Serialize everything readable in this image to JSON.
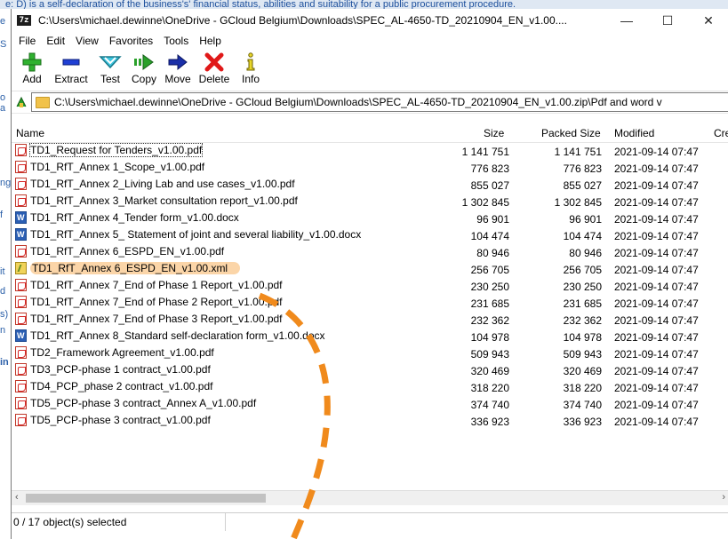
{
  "background_doc": {
    "top_text": "e: D) is a self-declaration of the business's' financial status, abilities and suitability for a public procurement procedure.",
    "letters": [
      "e",
      "S",
      "o",
      "a",
      "ng",
      "f",
      "it",
      "d",
      "s)",
      "n",
      "in"
    ]
  },
  "window": {
    "title": "C:\\Users\\michael.dewinne\\OneDrive - GCloud Belgium\\Downloads\\SPEC_AL-4650-TD_20210904_EN_v1.00....",
    "app_icon_text": "7z",
    "buttons": {
      "minimize": "—",
      "maximize": "☐",
      "close": "✕"
    }
  },
  "menu": [
    "File",
    "Edit",
    "View",
    "Favorites",
    "Tools",
    "Help"
  ],
  "toolbar": [
    {
      "label": "Add",
      "icon": "add-icon"
    },
    {
      "label": "Extract",
      "icon": "extract-icon"
    },
    {
      "label": "Test",
      "icon": "test-icon"
    },
    {
      "label": "Copy",
      "icon": "copy-icon"
    },
    {
      "label": "Move",
      "icon": "move-icon"
    },
    {
      "label": "Delete",
      "icon": "delete-icon"
    },
    {
      "label": "Info",
      "icon": "info-icon"
    }
  ],
  "address": {
    "path": "C:\\Users\\michael.dewinne\\OneDrive - GCloud Belgium\\Downloads\\SPEC_AL-4650-TD_20210904_EN_v1.00.zip\\Pdf and word v"
  },
  "columns": {
    "name": "Name",
    "size": "Size",
    "packed": "Packed Size",
    "modified": "Modified",
    "created": "Cre"
  },
  "files": [
    {
      "name": "TD1_Request for Tenders_v1.00.pdf",
      "type": "pdf",
      "size": "1 141 751",
      "packed": "1 141 751",
      "modified": "2021-09-14 07:47"
    },
    {
      "name": "TD1_RfT_Annex 1_Scope_v1.00.pdf",
      "type": "pdf",
      "size": "776 823",
      "packed": "776 823",
      "modified": "2021-09-14 07:47"
    },
    {
      "name": "TD1_RfT_Annex 2_Living Lab and use cases_v1.00.pdf",
      "type": "pdf",
      "size": "855 027",
      "packed": "855 027",
      "modified": "2021-09-14 07:47"
    },
    {
      "name": "TD1_RfT_Annex 3_Market consultation report_v1.00.pdf",
      "type": "pdf",
      "size": "1 302 845",
      "packed": "1 302 845",
      "modified": "2021-09-14 07:47"
    },
    {
      "name": "TD1_RfT_Annex 4_Tender form_v1.00.docx",
      "type": "docx",
      "size": "96 901",
      "packed": "96 901",
      "modified": "2021-09-14 07:47"
    },
    {
      "name": "TD1_RfT_Annex 5_ Statement of joint and several liability_v1.00.docx",
      "type": "docx",
      "size": "104 474",
      "packed": "104 474",
      "modified": "2021-09-14 07:47"
    },
    {
      "name": "TD1_RfT_Annex 6_ESPD_EN_v1.00.pdf",
      "type": "pdf",
      "size": "80 946",
      "packed": "80 946",
      "modified": "2021-09-14 07:47"
    },
    {
      "name": "TD1_RfT_Annex 6_ESPD_EN_v1.00.xml",
      "type": "xml",
      "size": "256 705",
      "packed": "256 705",
      "modified": "2021-09-14 07:47",
      "highlight": true
    },
    {
      "name": "TD1_RfT_Annex 7_End of Phase 1 Report_v1.00.pdf",
      "type": "pdf",
      "size": "230 250",
      "packed": "230 250",
      "modified": "2021-09-14 07:47"
    },
    {
      "name": "TD1_RfT_Annex 7_End of Phase 2 Report_v1.00.pdf",
      "type": "pdf",
      "size": "231 685",
      "packed": "231 685",
      "modified": "2021-09-14 07:47"
    },
    {
      "name": "TD1_RfT_Annex 7_End of Phase 3 Report_v1.00.pdf",
      "type": "pdf",
      "size": "232 362",
      "packed": "232 362",
      "modified": "2021-09-14 07:47"
    },
    {
      "name": "TD1_RfT_Annex 8_Standard self-declaration form_v1.00.docx",
      "type": "docx",
      "size": "104 978",
      "packed": "104 978",
      "modified": "2021-09-14 07:47"
    },
    {
      "name": "TD2_Framework Agreement_v1.00.pdf",
      "type": "pdf",
      "size": "509 943",
      "packed": "509 943",
      "modified": "2021-09-14 07:47"
    },
    {
      "name": "TD3_PCP-phase 1 contract_v1.00.pdf",
      "type": "pdf",
      "size": "320 469",
      "packed": "320 469",
      "modified": "2021-09-14 07:47"
    },
    {
      "name": "TD4_PCP_phase 2 contract_v1.00.pdf",
      "type": "pdf",
      "size": "318 220",
      "packed": "318 220",
      "modified": "2021-09-14 07:47"
    },
    {
      "name": "TD5_PCP-phase 3 contract_Annex A_v1.00.pdf",
      "type": "pdf",
      "size": "374 740",
      "packed": "374 740",
      "modified": "2021-09-14 07:47"
    },
    {
      "name": "TD5_PCP-phase 3 contract_v1.00.pdf",
      "type": "pdf",
      "size": "336 923",
      "packed": "336 923",
      "modified": "2021-09-14 07:47"
    }
  ],
  "status": {
    "text": "0 / 17 object(s) selected"
  },
  "colors": {
    "annotation_orange": "#f08a1c",
    "highlight": "#fbd5a8"
  }
}
